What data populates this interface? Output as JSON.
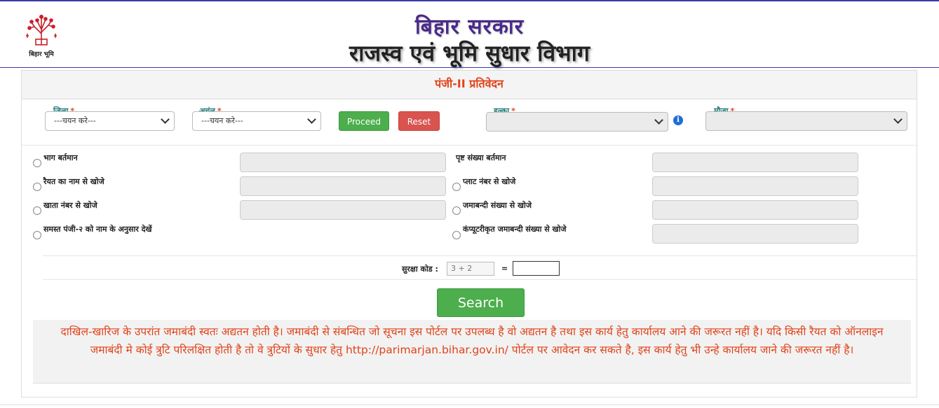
{
  "header": {
    "logo_text": "बिहार भूमि",
    "title_line1": "बिहार सरकार",
    "title_line2": "राजस्व एवं भूमि सुधार विभाग"
  },
  "panel": {
    "heading": "पंजी-II प्रतिवेदन"
  },
  "filters": {
    "district": {
      "label": "जिला",
      "required": "*",
      "value": "---चयन करे---"
    },
    "circle": {
      "label": "अचंल",
      "required": "*",
      "value": "---चयन करे---"
    },
    "proceed_label": "Proceed",
    "reset_label": "Reset",
    "halka": {
      "label": "हल्का",
      "required": "*",
      "value": ""
    },
    "mauza": {
      "label": "मौजा",
      "required": "*",
      "value": ""
    },
    "info_icon": "i"
  },
  "search_options": {
    "left": [
      "भाग बर्तमान",
      "रैयत का नाम से खोजे",
      "खाता नंबर से खोजे",
      "समस्त पंजी-२ को नाम के अनुसार देखें"
    ],
    "right": [
      "पृष्ट संख्या बर्तमान",
      "प्लाट नंबर से खोजे",
      "जमाबन्दी संख्या से खोजे",
      "कंप्यूटरीकृत जमाबन्दी संख्या से खोजे"
    ]
  },
  "captcha": {
    "label": "सुरक्षा कोड :",
    "question": "3 + 2",
    "equals": "=",
    "answer": ""
  },
  "search_label": "Search",
  "notice": "दाखिल-खारिज के उपरांत जमाबंदी स्वतः अद्यतन होती है। जमाबंदी से संबन्धित जो सूचना इस पोर्टल पर उपलब्ध है वो अद्यतन है तथा इस कार्य हेतु कार्यालय आने की जरूरत नहीं है। यदि किसी रैयत को ऑनलाइन जमाबंदी मे कोई त्रुटि परिलक्षित होती है तो वे त्रुटियों के सुधार हेतु http://parimarjan.bihar.gov.in/ पोर्टल पर आवेदन कर सकते है, इस कार्य हेतु भी उन्हे कार्यालय जाने की जरूरत नहीं है।",
  "colors": {
    "accent_orange": "#e0431a",
    "label_teal": "#1b7a74",
    "button_green": "#4cae4c",
    "button_red": "#d9534f",
    "header_purple": "#4a2a8a"
  }
}
